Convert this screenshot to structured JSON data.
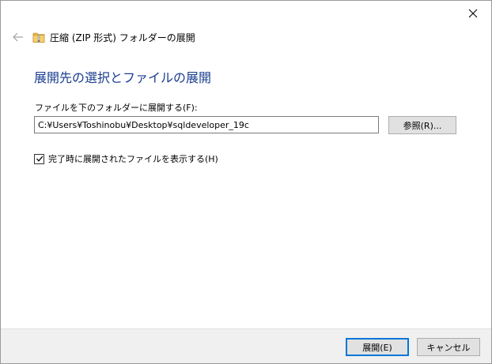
{
  "window": {
    "title": "圧縮 (ZIP 形式) フォルダーの展開",
    "icons": {
      "close": "close-icon",
      "back": "back-arrow-icon",
      "zip": "zip-folder-icon"
    }
  },
  "main": {
    "heading": "展開先の選択とファイルの展開",
    "dest_label": "ファイルを下のフォルダーに展開する(F):",
    "dest_path": "C:¥Users¥Toshinobu¥Desktop¥sqldeveloper_19c",
    "browse_label": "参照(R)...",
    "show_files_label": "完了時に展開されたファイルを表示する(H)",
    "show_files_checked": true
  },
  "footer": {
    "extract_label": "展開(E)",
    "cancel_label": "キャンセル"
  },
  "colors": {
    "heading": "#1a3d8f",
    "default_button_border": "#0078d7",
    "footer_bg": "#f0f0f0"
  }
}
